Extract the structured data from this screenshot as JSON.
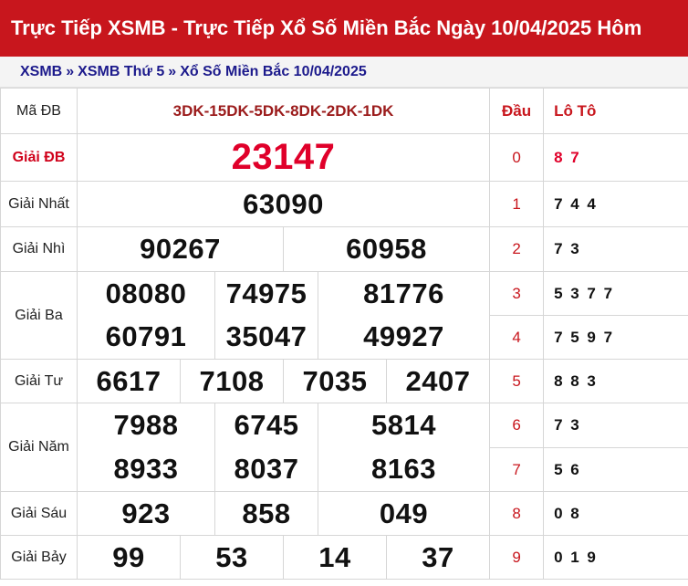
{
  "header": {
    "title": "Trực Tiếp XSMB - Trực Tiếp Xổ Số Miền Bắc Ngày 10/04/2025 Hôm"
  },
  "breadcrumb": {
    "items": [
      "XSMB",
      "XSMB Thứ 5",
      "Xổ Số Miền Bắc 10/04/2025"
    ],
    "separator": "»"
  },
  "table": {
    "ma_db": {
      "label": "Mã ĐB",
      "value": "3DK-15DK-5DK-8DK-2DK-1DK"
    },
    "headers": {
      "dau": "Đầu",
      "loto": "Lô Tô"
    },
    "prizes": {
      "db": {
        "label": "Giải ĐB",
        "numbers": [
          "23147"
        ]
      },
      "nhat": {
        "label": "Giải Nhất",
        "numbers": [
          "63090"
        ]
      },
      "nhi": {
        "label": "Giải Nhì",
        "numbers": [
          "90267",
          "60958"
        ]
      },
      "ba": {
        "label": "Giải Ba",
        "numbers": [
          "08080",
          "74975",
          "81776",
          "60791",
          "35047",
          "49927"
        ]
      },
      "tu": {
        "label": "Giải Tư",
        "numbers": [
          "6617",
          "7108",
          "7035",
          "2407"
        ]
      },
      "nam": {
        "label": "Giải Năm",
        "numbers": [
          "7988",
          "6745",
          "5814",
          "8933",
          "8037",
          "8163"
        ]
      },
      "sau": {
        "label": "Giải Sáu",
        "numbers": [
          "923",
          "858",
          "049"
        ]
      },
      "bay": {
        "label": "Giải Bảy",
        "numbers": [
          "99",
          "53",
          "14",
          "37"
        ]
      }
    },
    "loto": [
      {
        "dau": "0",
        "values": "8 7"
      },
      {
        "dau": "1",
        "values": "7 4 4"
      },
      {
        "dau": "2",
        "values": "7 3"
      },
      {
        "dau": "3",
        "values": "5 3 7 7"
      },
      {
        "dau": "4",
        "values": "7 5 9 7"
      },
      {
        "dau": "5",
        "values": "8 8 3"
      },
      {
        "dau": "6",
        "values": "7 3"
      },
      {
        "dau": "7",
        "values": "5 6"
      },
      {
        "dau": "8",
        "values": "0 8"
      },
      {
        "dau": "9",
        "values": "0 1 9"
      }
    ]
  },
  "colors": {
    "brand_red": "#c8161d",
    "special_red": "#e0002a",
    "link_blue": "#1c1a8c"
  }
}
